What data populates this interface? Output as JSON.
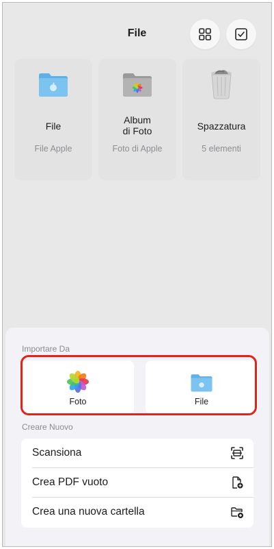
{
  "header": {
    "title": "File",
    "grid_icon": "grid-icon",
    "select_icon": "checkmark-square-icon"
  },
  "locations": [
    {
      "name": "File",
      "subtitle": "File Apple",
      "icon": "apple-folder-icon"
    },
    {
      "name": "Album di Foto",
      "name_line1": "Album",
      "name_line2": "di Foto",
      "subtitle": "Foto di Apple",
      "icon": "photos-folder-icon"
    },
    {
      "name": "Spazzatura",
      "subtitle": "5 elementi",
      "icon": "trash-icon"
    }
  ],
  "sheet": {
    "import_label": "Importare Da",
    "import_options": [
      {
        "label": "Foto",
        "icon": "photos-app-icon"
      },
      {
        "label": "File",
        "icon": "files-folder-icon"
      }
    ],
    "create_label": "Creare Nuovo",
    "create_options": [
      {
        "label": "Scansiona",
        "icon": "scan-icon"
      },
      {
        "label": "Crea PDF vuoto",
        "icon": "new-document-icon"
      },
      {
        "label": "Crea una nuova cartella",
        "icon": "new-folder-icon"
      }
    ]
  },
  "colors": {
    "folder_blue": "#6ab8ec",
    "highlight_red": "#e2231a",
    "background": "#e8e8e8"
  }
}
